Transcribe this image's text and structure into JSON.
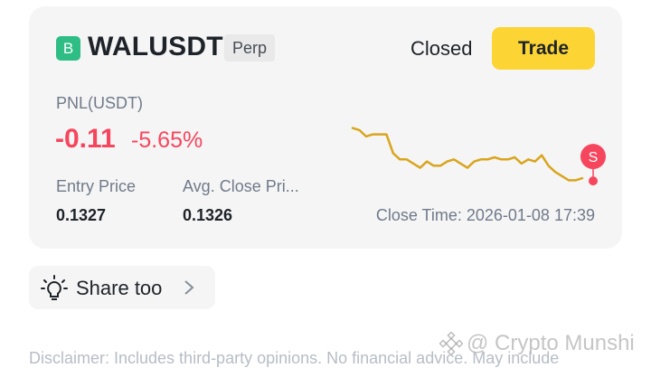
{
  "position": {
    "badge_letter": "B",
    "symbol": "WALUSDT",
    "contract_type": "Perp",
    "status": "Closed",
    "trade_label": "Trade",
    "pnl_label": "PNL(USDT)",
    "pnl_value": "-0.11",
    "pnl_percent": "-5.65%",
    "entry_price_label": "Entry Price",
    "entry_price": "0.1327",
    "avg_close_label": "Avg. Close Pri...",
    "avg_close_price": "0.1326",
    "close_time": "Close Time: 2026-01-08 17:39",
    "sell_marker": "S"
  },
  "colors": {
    "accent": "#fcd535",
    "loss": "#f6465d",
    "badge": "#2ebd85",
    "line": "#d9a51c"
  },
  "chart_data": {
    "type": "line",
    "title": "",
    "xlabel": "",
    "ylabel": "",
    "y": [
      100,
      99,
      96,
      97,
      97,
      97,
      88,
      85,
      85,
      83,
      81,
      84,
      82,
      82,
      84,
      85,
      83,
      81,
      84,
      85,
      85,
      86,
      85,
      85,
      86,
      83,
      85,
      84,
      87,
      82,
      79,
      77,
      75,
      75,
      76
    ],
    "ylim": [
      70,
      102
    ],
    "grid": false,
    "annotations": [
      {
        "label": "S",
        "at_index": 34
      }
    ]
  },
  "share": {
    "label": "Share too",
    "icon": "lightbulb-icon"
  },
  "disclaimer": "Disclaimer: Includes third-party opinions. No financial advice. May include",
  "watermark": "@ Crypto Munshi"
}
